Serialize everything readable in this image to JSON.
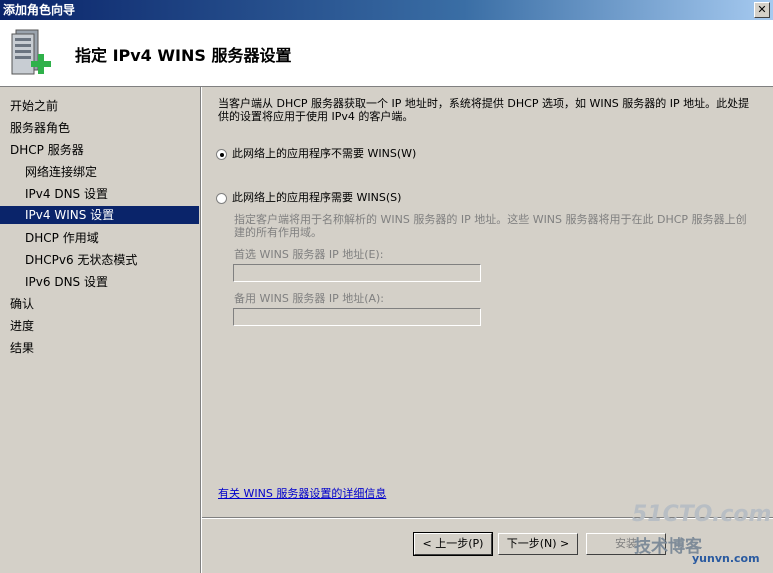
{
  "window": {
    "title": "添加角色向导",
    "close_label": "✕"
  },
  "header": {
    "title": "指定 IPv4 WINS 服务器设置",
    "icon": "server-add-icon"
  },
  "sidebar": {
    "items": [
      {
        "label": "开始之前",
        "level": 1,
        "active": false
      },
      {
        "label": "服务器角色",
        "level": 1,
        "active": false
      },
      {
        "label": "DHCP 服务器",
        "level": 1,
        "active": false
      },
      {
        "label": "网络连接绑定",
        "level": 2,
        "active": false
      },
      {
        "label": "IPv4 DNS 设置",
        "level": 2,
        "active": false
      },
      {
        "label": "IPv4 WINS 设置",
        "level": 2,
        "active": true
      },
      {
        "label": "DHCP 作用域",
        "level": 2,
        "active": false
      },
      {
        "label": "DHCPv6 无状态模式",
        "level": 2,
        "active": false
      },
      {
        "label": "IPv6 DNS 设置",
        "level": 2,
        "active": false
      },
      {
        "label": "确认",
        "level": 1,
        "active": false
      },
      {
        "label": "进度",
        "level": 1,
        "active": false
      },
      {
        "label": "结果",
        "level": 1,
        "active": false
      }
    ]
  },
  "main": {
    "description": "当客户端从 DHCP 服务器获取一个 IP 地址时，系统将提供 DHCP 选项，如 WINS 服务器的 IP 地址。此处提供的设置将应用于使用 IPv4 的客户端。",
    "option_not_required": "此网络上的应用程序不需要 WINS(W)",
    "option_required": "此网络上的应用程序需要 WINS(S)",
    "required_note": "指定客户端将用于名称解析的 WINS 服务器的 IP 地址。这些 WINS 服务器将用于在此 DHCP 服务器上创建的所有作用域。",
    "preferred_label": "首选 WINS 服务器 IP 地址(E):",
    "preferred_value": "",
    "alternate_label": "备用 WINS 服务器 IP 地址(A):",
    "alternate_value": "",
    "more_info_link": "有关 WINS 服务器设置的详细信息"
  },
  "buttons": {
    "back": "< 上一步(P)",
    "next": "下一步(N) >",
    "install": "安装"
  },
  "watermark": {
    "line1": "51CTO.com",
    "line2": "技术博客",
    "line3": "yunvn.com"
  }
}
